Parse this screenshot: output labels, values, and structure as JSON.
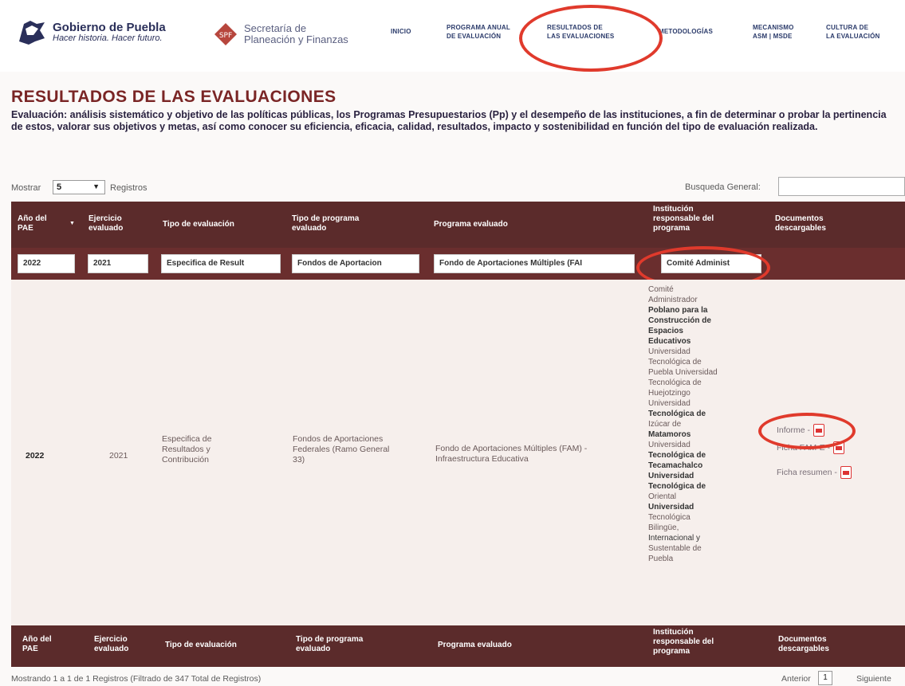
{
  "header": {
    "puebla_title": "Gobierno de Puebla",
    "puebla_slogan": "Hacer historia. Hacer futuro.",
    "spf_line1": "Secretaría de",
    "spf_line2": "Planeación y Finanzas",
    "nav": [
      {
        "label": "INICIO"
      },
      {
        "line1": "PROGRAMA ANUAL",
        "line2": "DE EVALUACIÓN"
      },
      {
        "line1": "RESULTADOS DE",
        "line2": "LAS EVALUACIONES"
      },
      {
        "label": "METODOLOGÍAS"
      },
      {
        "line1": "MECANISMO",
        "line2": "ASM | MSDE"
      },
      {
        "line1": "CULTURA DE",
        "line2": "LA EVALUACIÓN"
      }
    ]
  },
  "page": {
    "title": "RESULTADOS DE LAS EVALUACIONES",
    "description": "Evaluación: análisis sistemático y objetivo de las políticas públicas, los Programas Presupuestarios (Pp) y el desempeño de las instituciones, a fin de determinar o probar la pertinencia de estos, valorar sus objetivos y metas, así como conocer su eficiencia, eficacia, calidad, resultados, impacto y sostenibilidad en función del tipo de evaluación realizada."
  },
  "controls": {
    "show_label": "Mostrar",
    "page_size": "5",
    "records_label": "Registros",
    "search_label": "Busqueda General:"
  },
  "table": {
    "headers": {
      "year_line1": "Año del",
      "year_line2": "PAE",
      "exercise_line1": "Ejercicio",
      "exercise_line2": "evaluado",
      "type": "Tipo de evaluación",
      "program_type_line1": "Tipo de programa",
      "program_type_line2": "evaluado",
      "program": "Programa evaluado",
      "institution_line1": "Institución",
      "institution_line2": "responsable del",
      "institution_line3": "programa",
      "docs_line1": "Documentos",
      "docs_line2": "descargables"
    },
    "filters": {
      "year": "2022",
      "exercise": "2021",
      "type": "Especifica de Result",
      "program_type": "Fondos de Aportacion",
      "program": "Fondo de Aportaciones Múltiples (FAI",
      "institution": "Comité Administ"
    },
    "row": {
      "year": "2022",
      "exercise": "2021",
      "type_line1": "Especifica de",
      "type_line2": "Resultados y",
      "type_line3": "Contribución",
      "program_type_line1": "Fondos de Aportaciones",
      "program_type_line2": "Federales (Ramo General",
      "program_type_line3": "33)",
      "program_line1": "Fondo de Aportaciones Múltiples (FAM) -",
      "program_line2": "Infraestructura Educativa",
      "institution_lines": [
        "Comité",
        "Administrador",
        "Poblano para la",
        "Construcción de",
        "Espacios",
        "Educativos",
        "Universidad",
        "Tecnológica de",
        "Puebla Universidad",
        "Tecnológica de",
        "Huejotzingo",
        "Universidad",
        "Tecnológica de",
        "Izúcar de",
        "Matamoros",
        "Universidad",
        "Tecnológica de",
        "Tecamachalco",
        "Universidad",
        "Tecnológica de",
        "Oriental",
        "Universidad",
        "Tecnológica",
        "Bilingüe,",
        "Internacional y",
        "Sustentable de",
        "Puebla"
      ],
      "docs": [
        "Informe -",
        "Ficha FAM-E -",
        "Ficha resumen -"
      ]
    }
  },
  "footer": {
    "status": "Mostrando 1 a 1 de 1 Registros (Filtrado de 347 Total de Registros)",
    "prev": "Anterior",
    "page": "1",
    "next": "Siguiente"
  },
  "colors": {
    "header_maroon": "#5b2b2b",
    "title_maroon": "#7a2525",
    "annotation_red": "#e03a2c"
  }
}
